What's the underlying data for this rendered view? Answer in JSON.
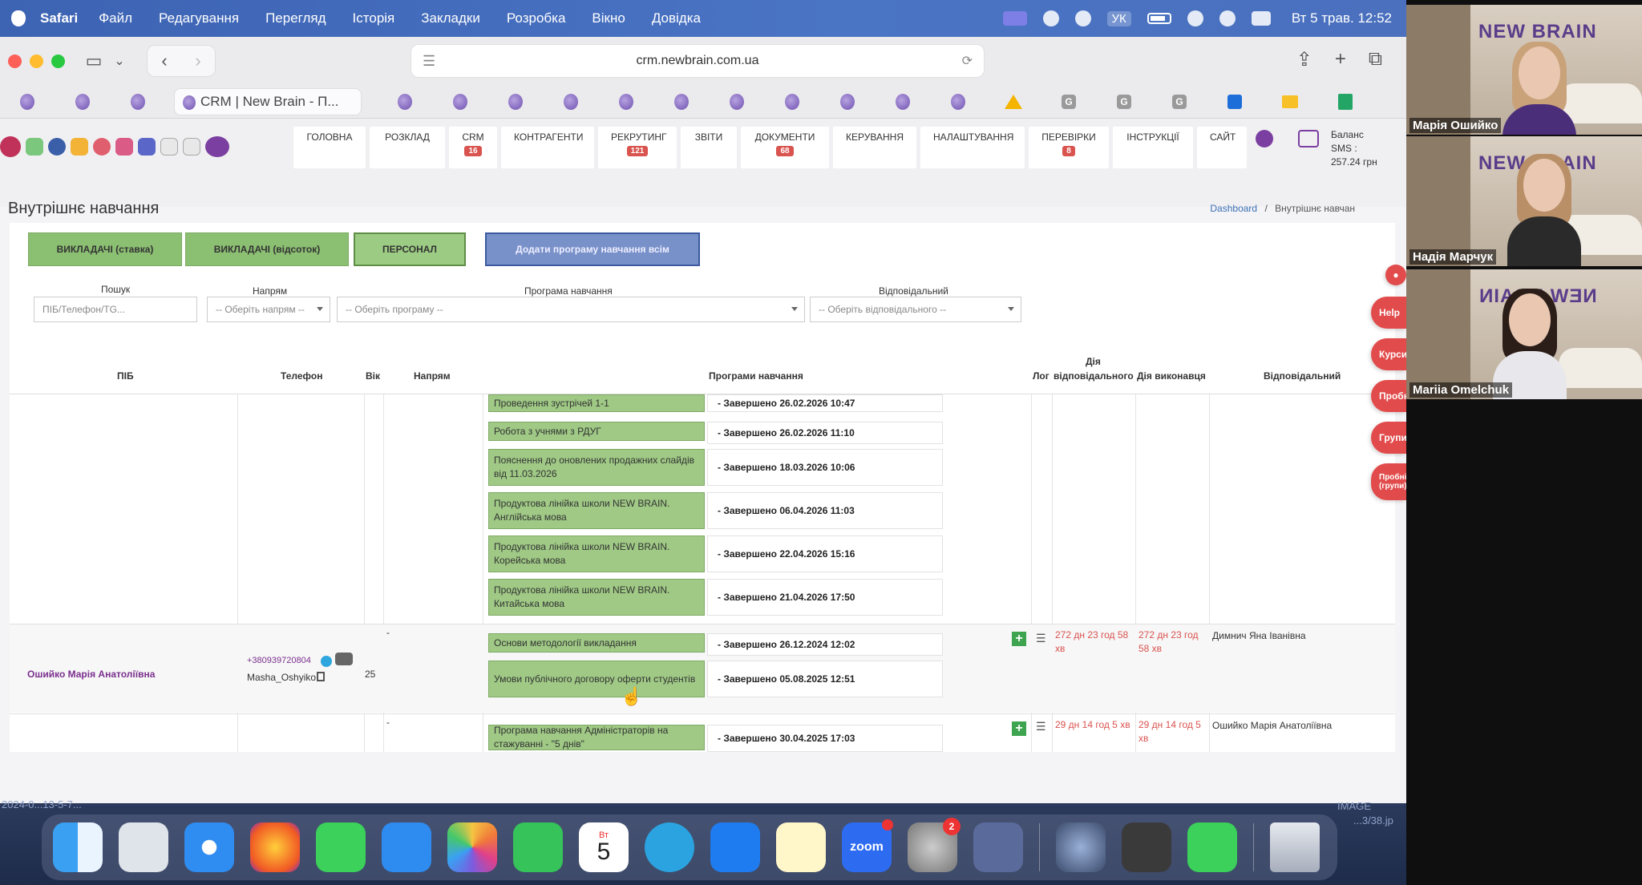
{
  "menubar": {
    "app": "Safari",
    "items": [
      "Файл",
      "Редагування",
      "Перегляд",
      "Історія",
      "Закладки",
      "Розробка",
      "Вікно",
      "Довідка"
    ],
    "lang": "УК",
    "clock": "Вт 5 трав.  12:52"
  },
  "browser": {
    "url": "crm.newbrain.com.ua",
    "active_tab": "CRM | New Brain - П..."
  },
  "crm": {
    "nav": [
      {
        "label": "ГОЛОВНА",
        "badge": ""
      },
      {
        "label": "РОЗКЛАД",
        "badge": ""
      },
      {
        "label": "CRM",
        "badge": "16"
      },
      {
        "label": "КОНТРАГЕНТИ",
        "badge": ""
      },
      {
        "label": "РЕКРУТИНГ",
        "badge": "121"
      },
      {
        "label": "ЗВІТИ",
        "badge": ""
      },
      {
        "label": "ДОКУМЕНТИ",
        "badge": "68"
      },
      {
        "label": "КЕРУВАННЯ",
        "badge": ""
      },
      {
        "label": "НАЛАШТУВАННЯ",
        "badge": ""
      },
      {
        "label": "ПЕРЕВІРКИ",
        "badge": "8"
      },
      {
        "label": "ІНСТРУКЦІЇ",
        "badge": ""
      },
      {
        "label": "САЙТ",
        "badge": ""
      }
    ],
    "balance": {
      "l1": "Баланс",
      "l2": "SMS :",
      "l3": "257.24 грн"
    },
    "page_title": "Внутрішнє навчання",
    "breadcrumb": {
      "home": "Dashboard",
      "sep": "/",
      "current": "Внутрішнє навчан"
    },
    "buttons": {
      "teachers_rate": "ВИКЛАДАЧІ (ставка)",
      "teachers_percent": "ВИКЛАДАЧІ (відсоток)",
      "staff": "ПЕРСОНАЛ",
      "add_program": "Додати програму навчання всім"
    },
    "filters": {
      "search_label": "Пошук",
      "search_placeholder": "ПІБ/Телефон/TG...",
      "direction_label": "Напрям",
      "direction_value": "-- Оберіть напрям --",
      "program_label": "Програма навчання",
      "program_value": "-- Оберіть програму --",
      "responsible_label": "Відповідальний",
      "responsible_value": "-- Оберіть відповідального --"
    },
    "table_headers": {
      "name": "ПІБ",
      "phone": "Телефон",
      "age": "Вік",
      "direction": "Напрям",
      "programs": "Програми навчання",
      "log": "Лог",
      "resp_action_1": "Дія",
      "resp_action_2": "відповідального",
      "exec_action": "Дія виконавця",
      "responsible": "Відповідальний"
    },
    "row1_programs": [
      {
        "name": "Проведення зустрічей 1-1",
        "status": "- Завершено 26.02.2026 10:47"
      },
      {
        "name": "Робота з учнями з РДУГ",
        "status": "- Завершено 26.02.2026 11:10"
      },
      {
        "name": "Пояснення до оновлених продажних слайдів від 11.03.2026",
        "status": "- Завершено 18.03.2026 10:06"
      },
      {
        "name": "Продуктова лінійка школи NEW BRAIN. Англійська мова",
        "status": "- Завершено 06.04.2026 11:03"
      },
      {
        "name": "Продуктова лінійка школи NEW BRAIN. Корейська мова",
        "status": "- Завершено 22.04.2026 15:16"
      },
      {
        "name": "Продуктова лінійка школи NEW BRAIN. Китайська мова",
        "status": "- Завершено 21.04.2026 17:50"
      }
    ],
    "row2": {
      "name": "Ошийко Марія Анатоліївна",
      "phone": "+380939720804",
      "tg": "Masha_Oshyiko",
      "age": "25",
      "direction": "-",
      "programs": [
        {
          "name": "Основи методології викладання",
          "status": "- Завершено 26.12.2024 12:02"
        },
        {
          "name": "Умови публічного договору оферти студентів",
          "status": "- Завершено 05.08.2025 12:51"
        }
      ],
      "resp_action": "272 дн 23 год 58 хв",
      "exec_action": "272 дн 23 год 58 хв",
      "responsible": "Димнич Яна Іванівна"
    },
    "row3": {
      "direction": "-",
      "programs": [
        {
          "name": "Програма навчання Адміністраторів на стажуванні - \"5 днів\"",
          "status": "- Завершено 30.04.2025 17:03"
        }
      ],
      "resp_action": "29 дн 14 год 5 хв",
      "exec_action": "29 дн 14 год 5 хв",
      "responsible": "Ошийко Марія Анатоліївна"
    },
    "side_tabs": [
      "Help",
      "Курси",
      "Пробні",
      "Групи",
      "Пробні (групи)"
    ]
  },
  "dock": {
    "calendar_month": "Вт",
    "calendar_day": "5",
    "zoom": "zoom",
    "settings_badge": "2",
    "left_text": "2024-0...13-5-7...",
    "right_text_1": "IMAGE",
    "right_text_2": "...3/38.jp"
  },
  "participants": [
    {
      "name": "Марія Ошийко",
      "brand": "NEW BRAIN"
    },
    {
      "name": "Надія Марчук",
      "brand": "NEW BRAIN"
    },
    {
      "name": "Mariia Omelchuk",
      "brand": "NEW BRAIN"
    }
  ]
}
